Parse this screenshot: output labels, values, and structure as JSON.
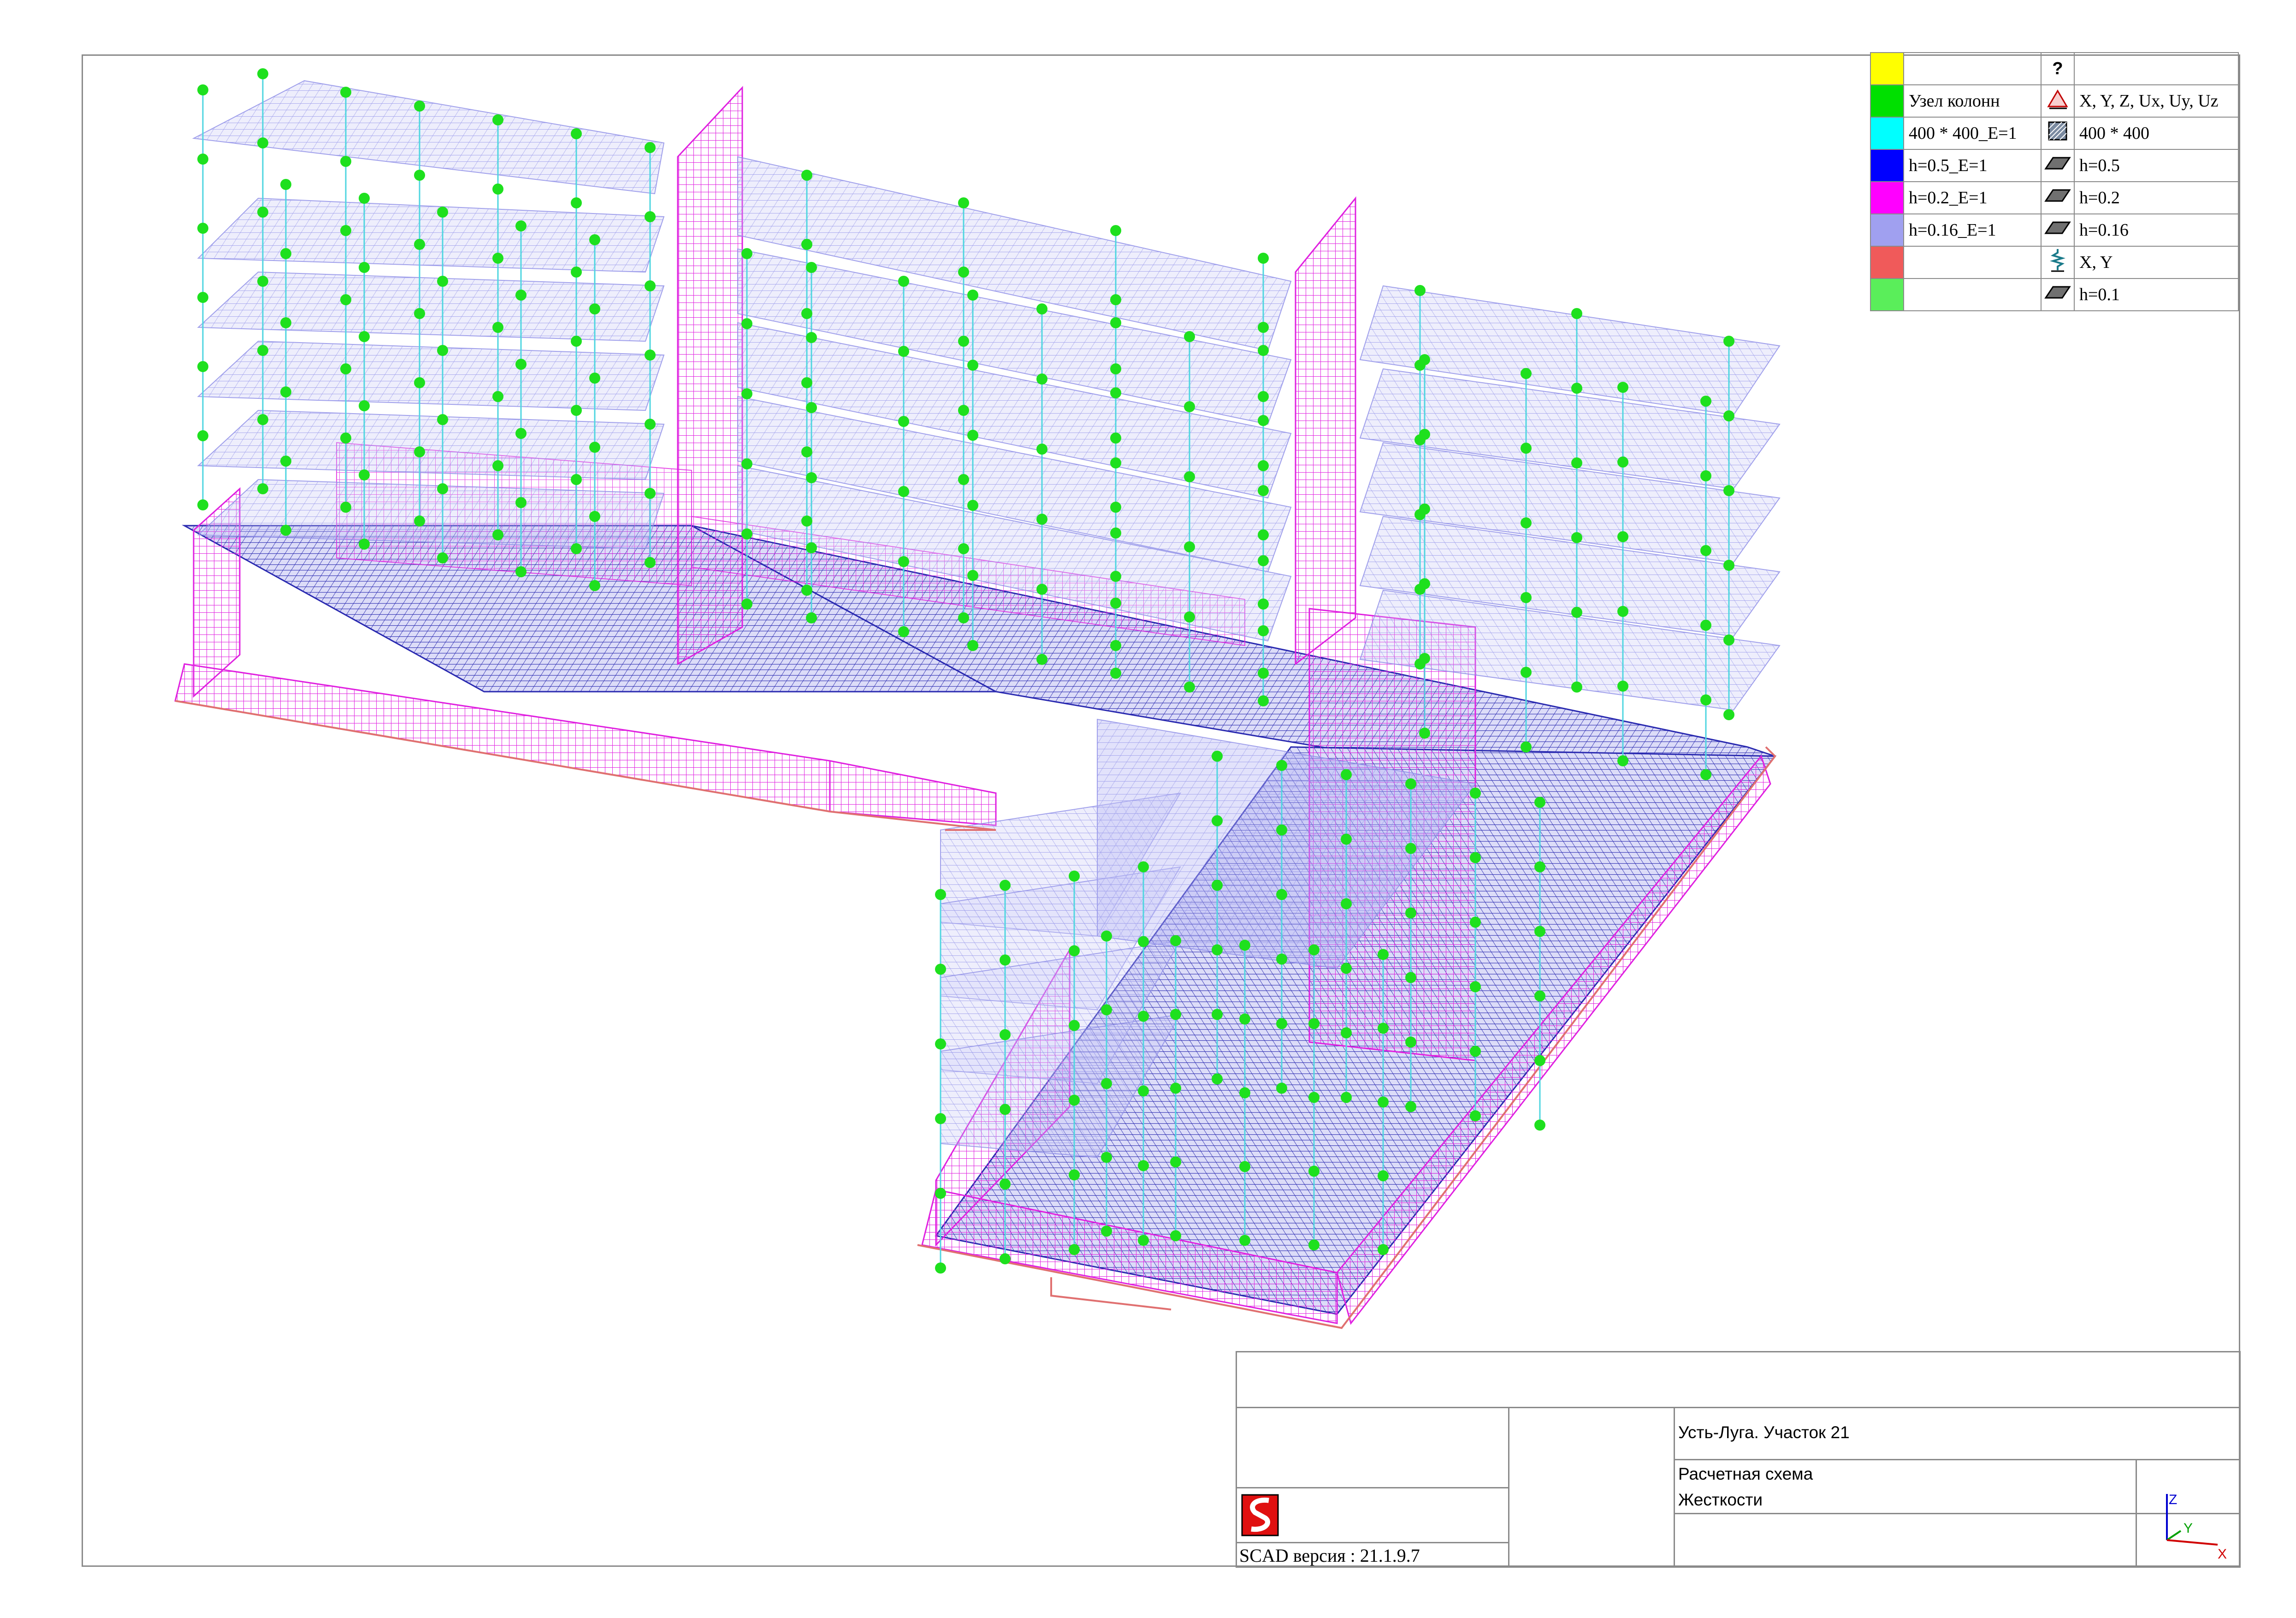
{
  "legend": {
    "header": {
      "col1": "",
      "icon": "?",
      "col2": ""
    },
    "rows": [
      {
        "swatch": "#ffff00",
        "label": "",
        "icon": "",
        "value": ""
      },
      {
        "swatch": "#00e000",
        "label": "Узел колонн",
        "icon": "restraint-icon",
        "value": "X, Y, Z, Ux, Uy, Uz"
      },
      {
        "swatch": "#00ffff",
        "label": "400 * 400_E=1",
        "icon": "section-icon",
        "value": "400 * 400"
      },
      {
        "swatch": "#0000ff",
        "label": "h=0.5_E=1",
        "icon": "plate-icon",
        "value": "h=0.5"
      },
      {
        "swatch": "#ff00ff",
        "label": "h=0.2_E=1",
        "icon": "plate-icon",
        "value": "h=0.2"
      },
      {
        "swatch": "#a0a0f0",
        "label": "h=0.16_E=1",
        "icon": "plate-icon",
        "value": "h=0.16"
      },
      {
        "swatch": "#f05a5a",
        "label": "",
        "icon": "spring-icon",
        "value": "X, Y"
      },
      {
        "swatch": "#5aee5a",
        "label": "",
        "icon": "plate-icon",
        "value": "h=0.1"
      }
    ]
  },
  "title_block": {
    "project": "Усть-Луга. Участок 21",
    "drawing_line1": "Расчетная схема",
    "drawing_line2": "Жесткости",
    "software": "SCAD версия : 21.1.9.7",
    "axes": {
      "z": "Z",
      "y": "Y",
      "x": "X"
    }
  },
  "colors": {
    "node": "#1ee01e",
    "column": "#4fd6e0",
    "slab": "#9898f0",
    "wall": "#e020e0",
    "foundation": "#2a2ab0",
    "support": "#e07070",
    "frame": "#8a8a8a"
  }
}
